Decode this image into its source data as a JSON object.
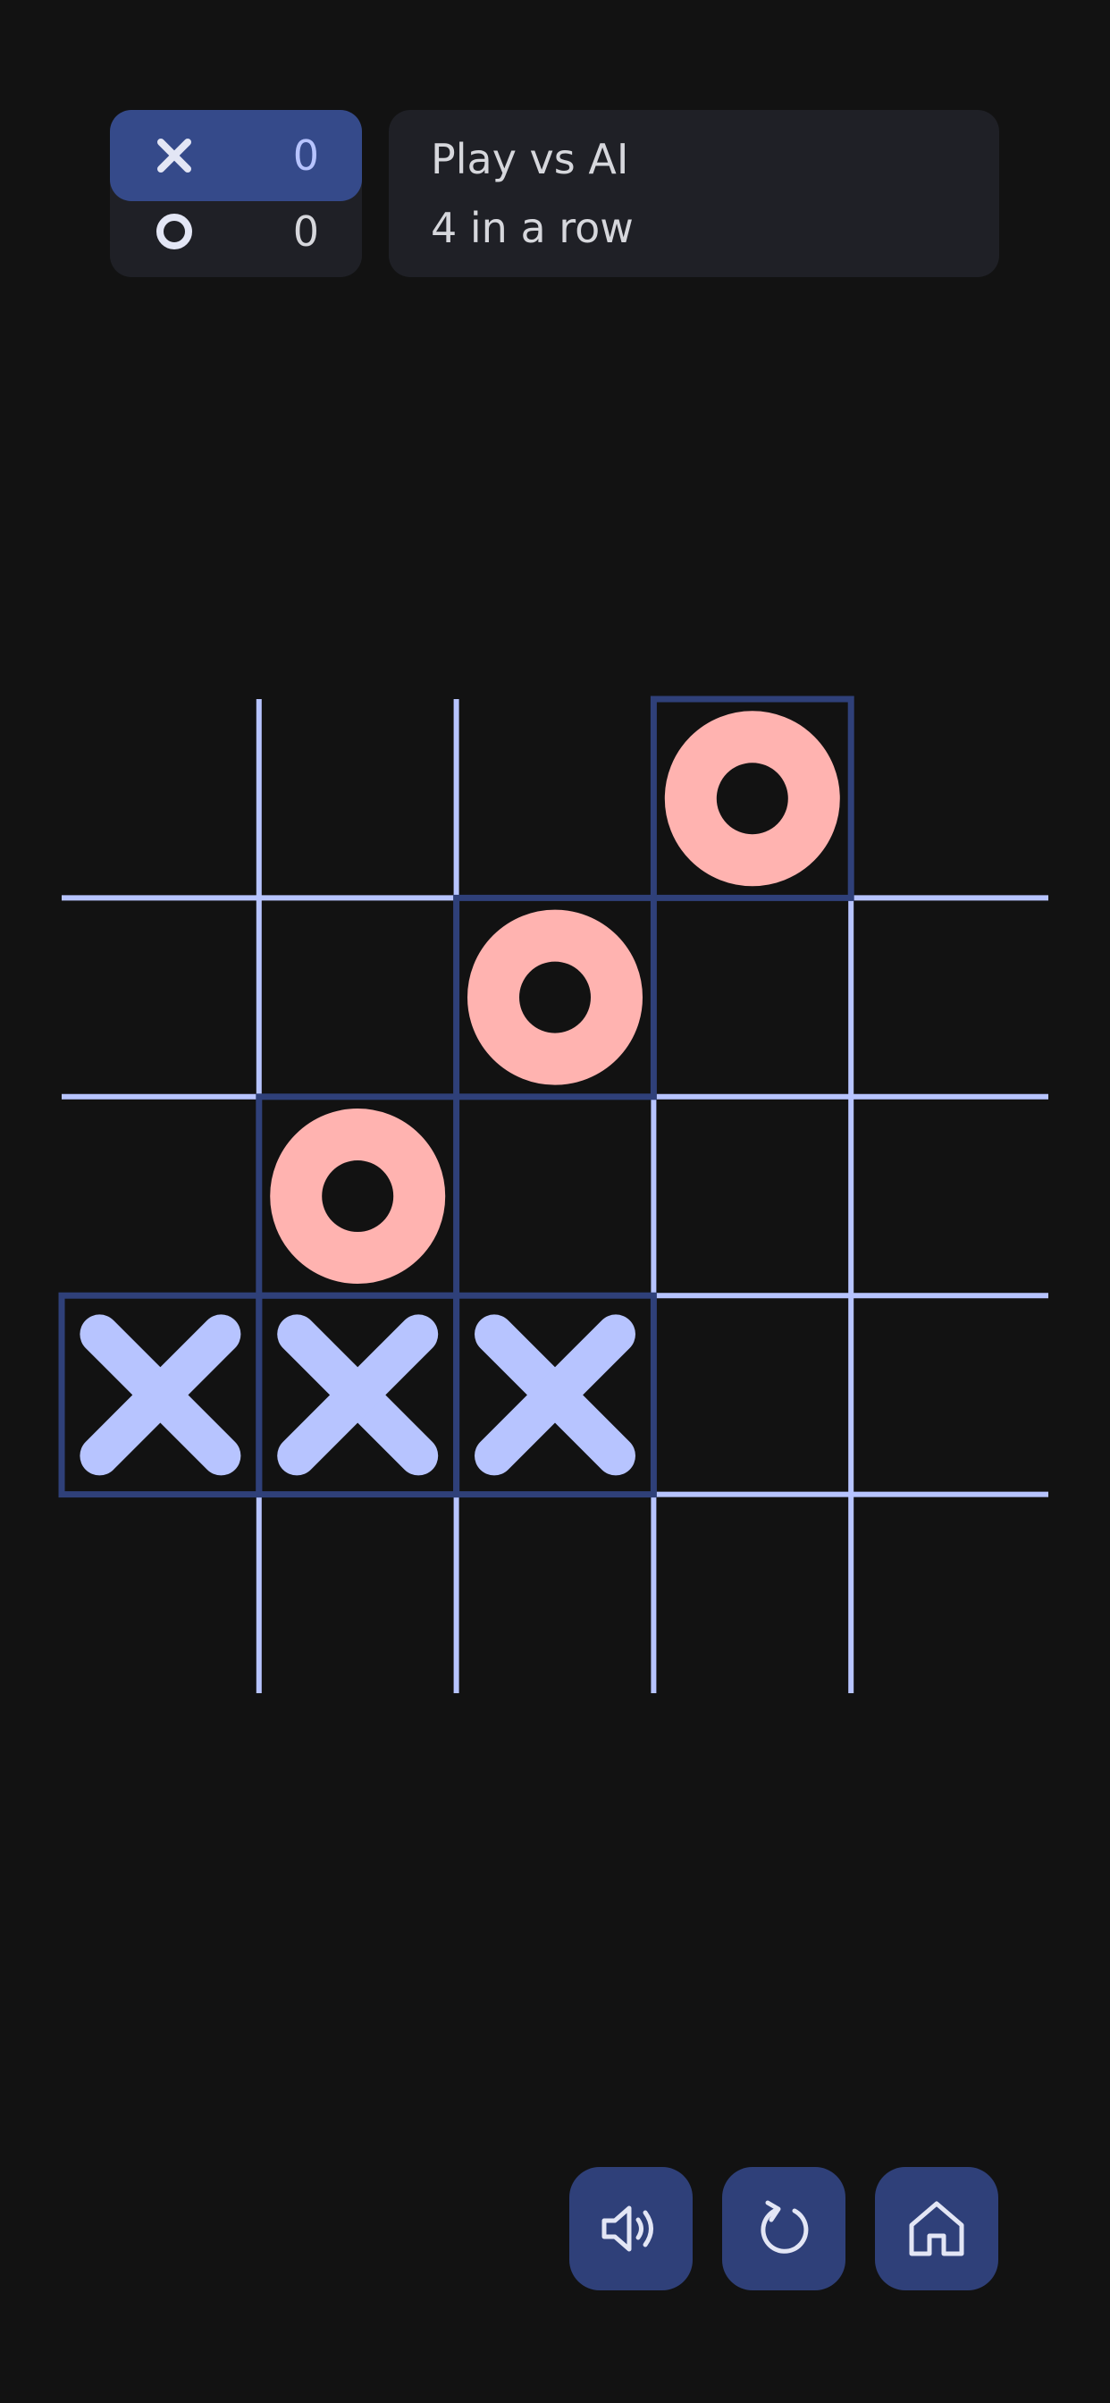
{
  "scoreboard": {
    "players": [
      {
        "id": "x",
        "symbol": "cross",
        "score": "0",
        "active": true
      },
      {
        "id": "o",
        "symbol": "ring",
        "score": "0",
        "active": false
      }
    ]
  },
  "info": {
    "mode": "Play vs AI",
    "rule": "4 in a row"
  },
  "board": {
    "size": 5,
    "cells": [
      [
        "",
        "",
        "",
        "O",
        ""
      ],
      [
        "",
        "",
        "O",
        "",
        ""
      ],
      [
        "",
        "O",
        "",
        "",
        ""
      ],
      [
        "X",
        "X",
        "X",
        "",
        ""
      ],
      [
        "",
        "",
        "",
        "",
        ""
      ]
    ],
    "highlighted_cells": [
      [
        0,
        3
      ],
      [
        1,
        2
      ],
      [
        2,
        1
      ],
      [
        3,
        0
      ],
      [
        3,
        1
      ],
      [
        3,
        2
      ]
    ]
  },
  "controls": [
    {
      "id": "sound",
      "icon": "speaker-icon"
    },
    {
      "id": "restart",
      "icon": "restart-icon"
    },
    {
      "id": "home",
      "icon": "home-icon"
    }
  ],
  "colors": {
    "background": "#121212",
    "panel": "#1f2026",
    "active_row": "#354a8a",
    "grid_line": "#b7c4ff",
    "highlight_line": "#2f4079",
    "x_mark": "#b7c4ff",
    "o_mark": "#ffb3b0",
    "button": "#2f4079",
    "button_icon": "#e3e6f5",
    "text": "#d6d7dc"
  }
}
